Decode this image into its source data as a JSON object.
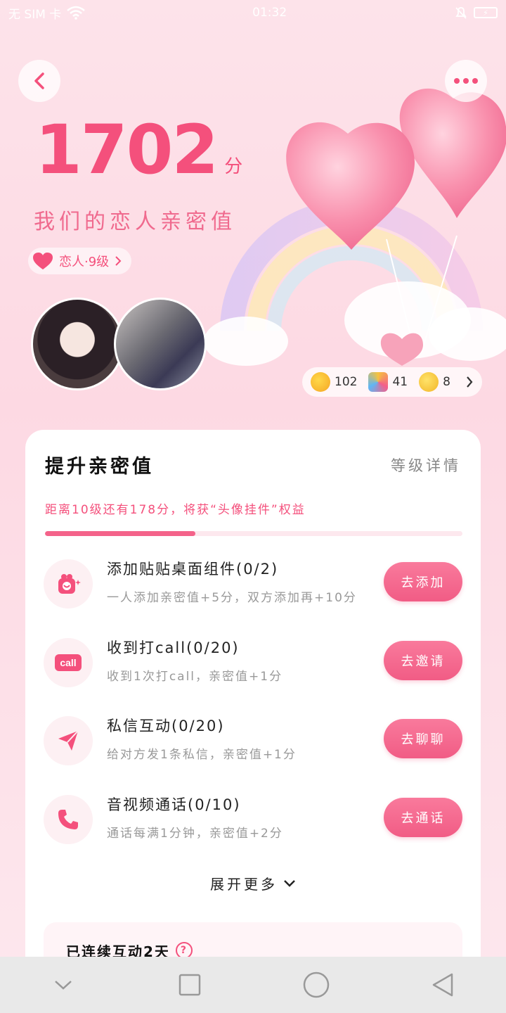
{
  "status": {
    "carrier": "无 SIM 卡",
    "time": "01:32",
    "battery": "⚡"
  },
  "header": {
    "score": "1702",
    "score_unit": "分",
    "subtitle": "我们的恋人亲密值",
    "level": "恋人·9级"
  },
  "stats": [
    {
      "icon": "hug-emoji-icon",
      "value": "102"
    },
    {
      "icon": "party-popper-icon",
      "value": "41"
    },
    {
      "icon": "sweat-emoji-icon",
      "value": "8"
    }
  ],
  "card": {
    "title": "提升亲密值",
    "level_link": "等级详情",
    "hint": "距离10级还有178分，将获“头像挂件”权益",
    "progress": 0.36,
    "tasks": [
      {
        "title": "添加贴贴桌面组件(0/2)",
        "desc": "一人添加亲密值+5分，双方添加再+10分",
        "button": "去添加",
        "icon": "widget-icon"
      },
      {
        "title": "收到打call(0/20)",
        "desc": "收到1次打call，亲密值+1分",
        "button": "去邀请",
        "icon": "call-badge-icon"
      },
      {
        "title": "私信互动(0/20)",
        "desc": "给对方发1条私信，亲密值+1分",
        "button": "去聊聊",
        "icon": "send-icon"
      },
      {
        "title": "音视频通话(0/10)",
        "desc": "通话每满1分钟，亲密值+2分",
        "button": "去通话",
        "icon": "phone-icon"
      }
    ],
    "expand": "展开更多",
    "streak": "已连续互动2天"
  },
  "colors": {
    "accent": "#f4507c",
    "background": "#fde3ea"
  }
}
